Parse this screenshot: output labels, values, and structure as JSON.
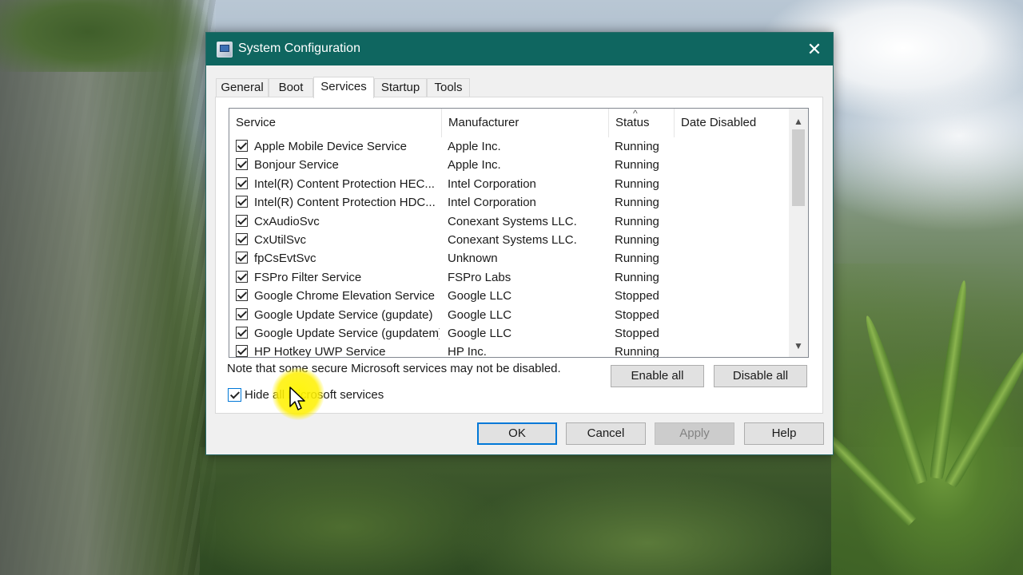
{
  "window": {
    "title": "System Configuration",
    "close_symbol": "✕"
  },
  "tabs": [
    {
      "label": "General"
    },
    {
      "label": "Boot"
    },
    {
      "label": "Services",
      "active": true
    },
    {
      "label": "Startup"
    },
    {
      "label": "Tools"
    }
  ],
  "services_table": {
    "columns": [
      {
        "label": "Service"
      },
      {
        "label": "Manufacturer"
      },
      {
        "label": "Status"
      },
      {
        "label": "Date Disabled"
      }
    ],
    "sort_indicator": "^",
    "rows": [
      {
        "service": "Apple Mobile Device Service",
        "manufacturer": "Apple Inc.",
        "status": "Running",
        "date_disabled": "",
        "checked": true
      },
      {
        "service": "Bonjour Service",
        "manufacturer": "Apple Inc.",
        "status": "Running",
        "date_disabled": "",
        "checked": true
      },
      {
        "service": "Intel(R) Content Protection HEC...",
        "manufacturer": "Intel Corporation",
        "status": "Running",
        "date_disabled": "",
        "checked": true
      },
      {
        "service": "Intel(R) Content Protection HDC...",
        "manufacturer": "Intel Corporation",
        "status": "Running",
        "date_disabled": "",
        "checked": true
      },
      {
        "service": "CxAudioSvc",
        "manufacturer": "Conexant Systems LLC.",
        "status": "Running",
        "date_disabled": "",
        "checked": true
      },
      {
        "service": "CxUtilSvc",
        "manufacturer": "Conexant Systems LLC.",
        "status": "Running",
        "date_disabled": "",
        "checked": true
      },
      {
        "service": "fpCsEvtSvc",
        "manufacturer": "Unknown",
        "status": "Running",
        "date_disabled": "",
        "checked": true
      },
      {
        "service": "FSPro Filter Service",
        "manufacturer": "FSPro Labs",
        "status": "Running",
        "date_disabled": "",
        "checked": true
      },
      {
        "service": "Google Chrome Elevation Service",
        "manufacturer": "Google LLC",
        "status": "Stopped",
        "date_disabled": "",
        "checked": true
      },
      {
        "service": "Google Update Service (gupdate)",
        "manufacturer": "Google LLC",
        "status": "Stopped",
        "date_disabled": "",
        "checked": true
      },
      {
        "service": "Google Update Service (gupdatem)",
        "manufacturer": "Google LLC",
        "status": "Stopped",
        "date_disabled": "",
        "checked": true
      },
      {
        "service": "HP Hotkey UWP Service",
        "manufacturer": "HP Inc.",
        "status": "Running",
        "date_disabled": "",
        "checked": true
      }
    ]
  },
  "note": "Note that some secure Microsoft services may not be disabled.",
  "buttons": {
    "enable_all": "Enable all",
    "disable_all": "Disable all",
    "ok": "OK",
    "cancel": "Cancel",
    "apply": "Apply",
    "help": "Help"
  },
  "hide_microsoft": {
    "label": "Hide all Microsoft services",
    "checked": true
  },
  "colors": {
    "titlebar": "#0f6660",
    "accent": "#0078d7",
    "cursor_highlight": "#fff500"
  }
}
